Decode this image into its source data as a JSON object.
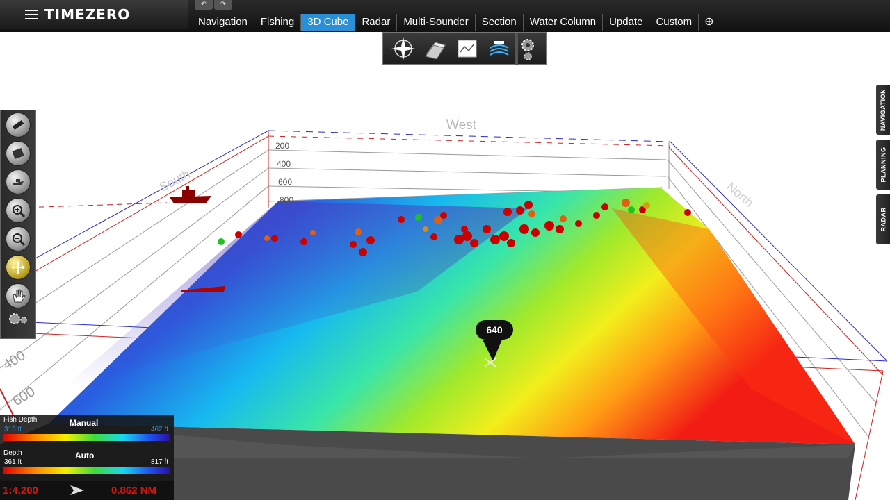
{
  "app": {
    "title": "TIMEZERO",
    "undo": "↶",
    "redo": "↷"
  },
  "tabs": [
    {
      "label": "Navigation",
      "active": false
    },
    {
      "label": "Fishing",
      "active": false
    },
    {
      "label": "3D Cube",
      "active": true
    },
    {
      "label": "Radar",
      "active": false
    },
    {
      "label": "Multi-Sounder",
      "active": false
    },
    {
      "label": "Section",
      "active": false
    },
    {
      "label": "Water Column",
      "active": false
    },
    {
      "label": "Update",
      "active": false
    },
    {
      "label": "Custom",
      "active": false
    }
  ],
  "add_tab": "⊕",
  "toolbar_icons": [
    "compass-rose-icon",
    "layers-icon",
    "chart-icon",
    "sounder-icon",
    "settings-icon"
  ],
  "left_tools": [
    "route-icon",
    "event-icon",
    "boat-icon",
    "zoom-in-icon",
    "zoom-out-icon",
    "move-icon",
    "hand-icon",
    "settings-icon"
  ],
  "side_tabs": [
    "NAVIGATION",
    "PLANNING",
    "RADAR"
  ],
  "scene": {
    "directions": {
      "west": "West",
      "south": "South",
      "north": "North"
    },
    "back_depths": [
      "200",
      "400",
      "600",
      "800"
    ],
    "front_depths": [
      "400",
      "600"
    ],
    "cursor_depth": "640"
  },
  "legend": {
    "fish_depth": {
      "label": "Fish Depth",
      "mode": "Manual",
      "min": "315 ft",
      "max": "462 ft"
    },
    "depth": {
      "label": "Depth",
      "mode": "Auto",
      "min": "361 ft",
      "max": "817 ft"
    },
    "scale": "1:4,200",
    "range": "0.862 NM"
  },
  "colors": {
    "accent": "#2a8fd6",
    "scale_text": "#d9140e"
  }
}
